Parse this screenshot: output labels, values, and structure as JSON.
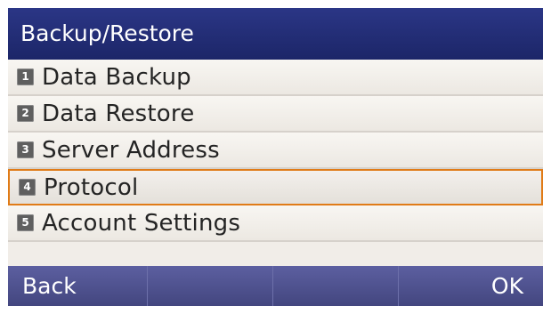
{
  "title": "Backup/Restore",
  "menu": {
    "items": [
      {
        "number": "1",
        "label": "Data Backup"
      },
      {
        "number": "2",
        "label": "Data Restore"
      },
      {
        "number": "3",
        "label": "Server Address"
      },
      {
        "number": "4",
        "label": "Protocol",
        "selected": true
      },
      {
        "number": "5",
        "label": "Account Settings"
      }
    ]
  },
  "softkeys": [
    "Back",
    "",
    "",
    "OK"
  ],
  "colors": {
    "title_bar": "#1c2668",
    "softkey_bar": "#4a4d8a",
    "selection_border": "#e07b17",
    "menu_background": "#f1ede8"
  }
}
